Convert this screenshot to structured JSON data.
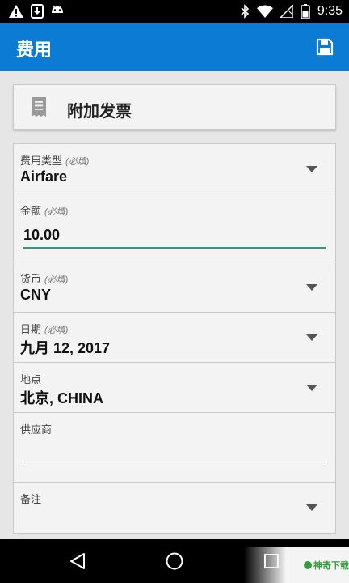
{
  "status_bar": {
    "time": "9:35",
    "left_icons": [
      "warning-icon",
      "download-icon",
      "android-icon"
    ],
    "right_icons": [
      "bluetooth-icon",
      "wifi-icon",
      "signal-icon",
      "battery-icon"
    ]
  },
  "app_bar": {
    "title": "费用",
    "action_icon": "save-icon",
    "color": "#0b7bd3"
  },
  "attach_receipt": {
    "icon": "receipt-icon",
    "label": "附加发票"
  },
  "form": {
    "expense_type": {
      "label": "费用类型",
      "required": "(必填)",
      "value": "Airfare"
    },
    "amount": {
      "label": "金额",
      "required": "(必填)",
      "value": "10.00"
    },
    "currency": {
      "label": "货币",
      "required": "(必填)",
      "value": "CNY"
    },
    "date": {
      "label": "日期",
      "required": "(必填)",
      "value": "九月 12, 2017"
    },
    "location": {
      "label": "地点",
      "value": "北京, CHINA"
    },
    "vendor": {
      "label": "供应商",
      "value": ""
    },
    "notes": {
      "label": "备注"
    },
    "accent_color": "#2a9d80"
  },
  "nav_bar": {
    "buttons": [
      "back-icon",
      "home-icon",
      "recents-icon"
    ]
  },
  "watermark": {
    "text": "神奇下载"
  }
}
